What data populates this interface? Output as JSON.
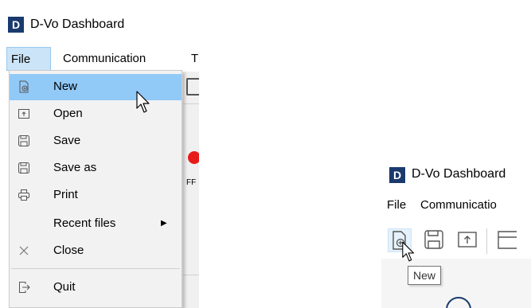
{
  "left": {
    "app_logo_letter": "D",
    "window_title": "D-Vo Dashboard",
    "menu": {
      "file": "File",
      "communication": "Communication",
      "truncated": "T"
    },
    "file_menu_items": [
      {
        "label": "New",
        "icon": "new-file-icon"
      },
      {
        "label": "Open",
        "icon": "open-file-icon"
      },
      {
        "label": "Save",
        "icon": "save-icon"
      },
      {
        "label": "Save as",
        "icon": "save-as-icon"
      },
      {
        "label": "Print",
        "icon": "print-icon"
      },
      {
        "label": "Recent files",
        "icon": "",
        "submenu": true
      },
      {
        "label": "Close",
        "icon": "close-icon"
      },
      {
        "label": "Quit",
        "icon": "quit-icon"
      }
    ],
    "background_fragment": "FF",
    "submenu_arrow": "▶"
  },
  "right": {
    "app_logo_letter": "D",
    "window_title": "D-Vo Dashboard",
    "menu": {
      "file": "File",
      "communication": "Communicatio"
    },
    "tooltip": "New"
  },
  "colors": {
    "highlight": "#91c9f7",
    "menu_active": "#cce4f7",
    "logo": "#1a3a6e",
    "red_status": "#e81b1b"
  }
}
